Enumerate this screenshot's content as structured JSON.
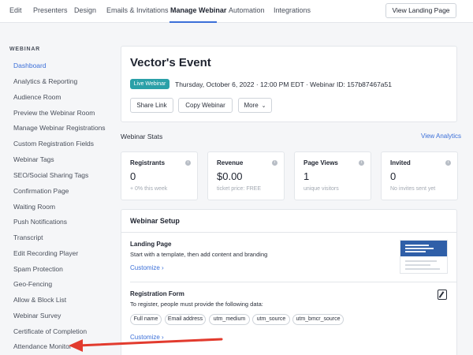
{
  "topnav": {
    "tabs": [
      {
        "label": "Edit"
      },
      {
        "label": "Presenters"
      },
      {
        "label": "Design"
      },
      {
        "label": "Emails & Invitations"
      },
      {
        "label": "Manage Webinar"
      },
      {
        "label": "Automation"
      },
      {
        "label": "Integrations"
      }
    ],
    "active_tab": "Manage Webinar",
    "landing_button": "View Landing Page"
  },
  "sidebar": {
    "section_label": "WEBINAR",
    "items": [
      {
        "label": "Dashboard"
      },
      {
        "label": "Analytics & Reporting"
      },
      {
        "label": "Audience Room"
      },
      {
        "label": "Preview the Webinar Room"
      },
      {
        "label": "Manage Webinar Registrations"
      },
      {
        "label": "Custom Registration Fields"
      },
      {
        "label": "Webinar Tags"
      },
      {
        "label": "SEO/Social Sharing Tags"
      },
      {
        "label": "Confirmation Page"
      },
      {
        "label": "Waiting Room"
      },
      {
        "label": "Push Notifications"
      },
      {
        "label": "Transcript"
      },
      {
        "label": "Edit Recording Player"
      },
      {
        "label": "Spam Protection"
      },
      {
        "label": "Geo-Fencing"
      },
      {
        "label": "Allow & Block List"
      },
      {
        "label": "Webinar Survey"
      },
      {
        "label": "Certificate of Completion"
      },
      {
        "label": "Attendance Monitor"
      }
    ],
    "active_item": "Dashboard"
  },
  "event": {
    "title": "Vector's Event",
    "status_badge": "Live Webinar",
    "meta": "Thursday, October 6, 2022 · 12:00 PM EDT · Webinar ID: 157b87467a51",
    "buttons": {
      "share": "Share Link",
      "copy": "Copy Webinar",
      "more": "More"
    }
  },
  "stats": {
    "heading": "Webinar Stats",
    "view_analytics": "View Analytics",
    "cards": [
      {
        "label": "Registrants",
        "value": "0",
        "sub": "+ 0% this week"
      },
      {
        "label": "Revenue",
        "value": "$0.00",
        "sub": "ticket price: FREE"
      },
      {
        "label": "Page Views",
        "value": "1",
        "sub": "unique visitors"
      },
      {
        "label": "Invited",
        "value": "0",
        "sub": "No invites sent yet"
      }
    ]
  },
  "setup": {
    "title": "Webinar Setup",
    "landing_page": {
      "title": "Landing Page",
      "description": "Start with a template, then add content and branding",
      "customize": "Customize"
    },
    "registration_form": {
      "title": "Registration Form",
      "description": "To register, people must provide the following data:",
      "fields": [
        "Full name",
        "Email address",
        "utm_medium",
        "utm_source",
        "utm_bmcr_source"
      ],
      "customize": "Customize"
    }
  },
  "colors": {
    "accent": "#3b6fd8",
    "badge": "#2aa0a8",
    "arrow": "#e23b2e"
  }
}
